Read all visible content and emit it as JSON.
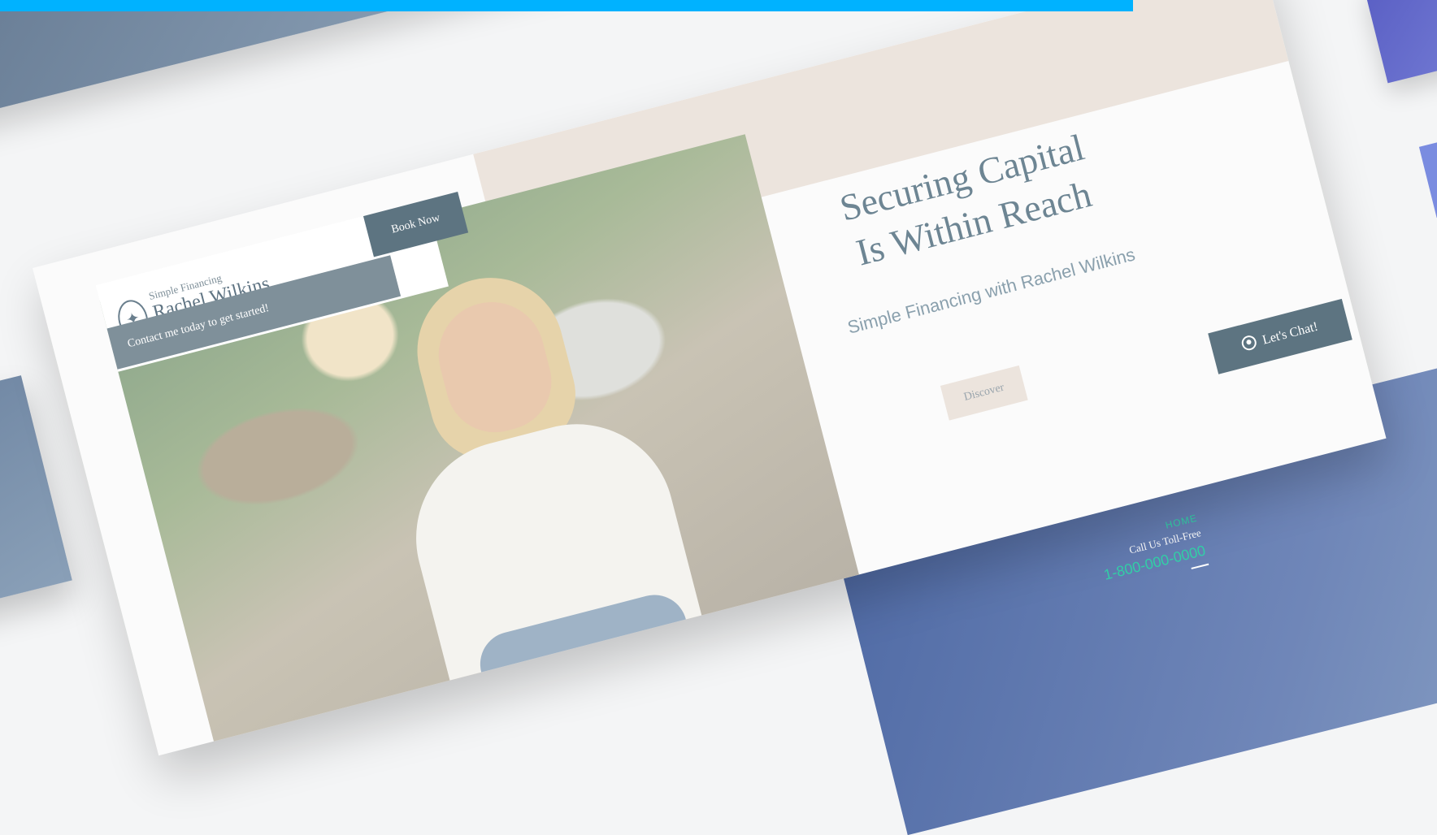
{
  "header": {
    "brand_small": "Simple Financing",
    "brand_name": "Rachel Wilkins",
    "book_now": "Book Now",
    "contact_text": "Contact me today to get started!"
  },
  "hero": {
    "title_line1": "Securing Capital",
    "title_line2": "Is Within Reach",
    "subtitle": "Simple Financing with Rachel Wilkins",
    "discover_button": "Discover",
    "chat_button": "Let's Chat!"
  },
  "footer": {
    "nav_home": "HOME",
    "call_label": "Call Us Toll-Free",
    "phone": "1-800-000-0000"
  },
  "colors": {
    "accent_bar": "#00b2ff",
    "slate": "#5d7481",
    "beige": "#ece4dd",
    "footer_green": "#33d0a8"
  },
  "icons": [
    "leaf-logo-icon",
    "user-chat-icon"
  ]
}
